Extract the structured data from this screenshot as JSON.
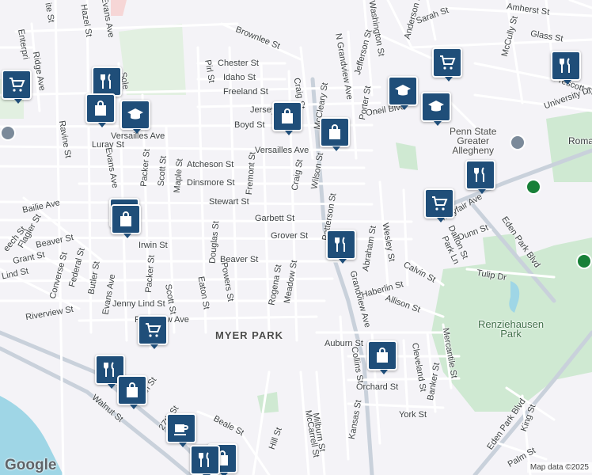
{
  "streets": [
    "Amherst St",
    "Sarah St",
    "Glass St",
    "McCully St",
    "Anderson St",
    "Washington St",
    "Jefferson St",
    "Brownlee St",
    "Chester St",
    "Idaho St",
    "Freeland St",
    "Jersey St",
    "Boyd St",
    "Oneil Blvd",
    "Prescott St",
    "University Dr",
    "Versailles Ave",
    "Atcheson St",
    "Dinsmore St",
    "Stewart St",
    "Garbett St",
    "Grover St",
    "Irwin St",
    "Beaver St",
    "Bailie Ave",
    "Jenny Lind St",
    "Riverview St",
    "Riverview Ave",
    "Luray St",
    "Ravine St",
    "Hazel St",
    "Evans Ave",
    "Packer St",
    "Scott St",
    "Maple St",
    "Fremont St",
    "Craig St",
    "Wilson St",
    "McCleary St",
    "N Grandview Ave",
    "Porter St",
    "Patterson St",
    "Abraham St",
    "Wesley St",
    "Calvin St",
    "Haberlin St",
    "Allison St",
    "Mayfair Ave",
    "Dunn St",
    "Dalton St",
    "Park Ln",
    "Eden Park Blvd",
    "Tulip Dr",
    "Grandview Ave",
    "Auburn St",
    "Collins St",
    "Cleveland St",
    "Mercantile St",
    "Banker St",
    "Orchard St",
    "York St",
    "Kansas St",
    "Milburn St",
    "McCarrell St",
    "Hill St",
    "Beale St",
    "27th St",
    "26th St",
    "Walnut St",
    "Palm St",
    "King St",
    "Douglas St",
    "Powers St",
    "Eaton St",
    "Rogena St",
    "Meadow St",
    "Butler St",
    "Converse St",
    "Federal St",
    "Grant St",
    "Flagler St",
    "Lind St",
    "Pirl St",
    "Federal St",
    "Enterprise St",
    "Ridge Ave",
    "Soles St",
    "Ite St"
  ],
  "labels": {
    "amherst": "Amherst St",
    "sarah": "Sarah St",
    "glass": "Glass St",
    "mccully": "McCully St",
    "anderson": "Anderson St",
    "washington": "Washington St",
    "jefferson": "Jefferson St",
    "brownlee": "Brownlee St",
    "chester": "Chester St",
    "idaho": "Idaho St",
    "freeland": "Freeland St",
    "jersey": "Jersey St",
    "boyd": "Boyd St",
    "oneil": "Oneil Blvd",
    "prescott": "Prescott St",
    "university": "University Dr",
    "versailles1": "Versailles Ave",
    "versailles2": "Versailles Ave",
    "atcheson": "Atcheson St",
    "dinsmore": "Dinsmore St",
    "stewart": "Stewart St",
    "garbett": "Garbett St",
    "grover": "Grover St",
    "irwin": "Irwin St",
    "beaver1": "Beaver St",
    "beaver2": "Beaver St",
    "bailie": "Bailie Ave",
    "jenny": "Jenny Lind St",
    "riverview_st": "Riverview St",
    "riverview_ave": "Riverview Ave",
    "luray": "Luray St",
    "ravine": "Ravine St",
    "hazel": "Hazel St",
    "evans1": "Evans Ave",
    "evans2": "Evans Ave",
    "evans3": "Evans Ave",
    "packer1": "Packer St",
    "packer2": "Packer St",
    "scott1": "Scott St",
    "scott2": "Scott St",
    "maple": "Maple St",
    "fremont": "Fremont St",
    "craig1": "Craig St",
    "craig2": "Craig St",
    "wilson": "Wilson St",
    "mccleary": "McCleary St",
    "ngrandview": "N Grandview Ave",
    "porter": "Porter St",
    "patterson": "Patterson St",
    "abraham": "Abraham St",
    "wesley": "Wesley St",
    "calvin": "Calvin St",
    "haberlin": "Haberlin St",
    "allison": "Allison St",
    "mayfair": "Mayfair Ave",
    "dunn": "Dunn St",
    "dalton": "Dalton St",
    "parkln": "Park Ln",
    "eden1": "Eden Park Blvd",
    "eden2": "Eden Park Blvd",
    "tulip": "Tulip Dr",
    "grandview": "Grandview Ave",
    "auburn": "Auburn St",
    "collins": "Collins St",
    "cleveland": "Cleveland St",
    "mercantile": "Mercantile St",
    "banker": "Banker St",
    "orchard": "Orchard St",
    "york": "York St",
    "kansas": "Kansas St",
    "milburn": "Milburn St",
    "mccarrell": "McCarrell St",
    "hill": "Hill St",
    "beale": "Beale St",
    "st27": "27th St",
    "st26": "26th St",
    "walnut": "Walnut St",
    "palm": "Palm St",
    "king": "King St",
    "douglas": "Douglas St",
    "powers": "Powers St",
    "eaton": "Eaton St",
    "rogena": "Rogena St",
    "meadow": "Meadow St",
    "butler": "Butler St",
    "converse": "Converse St",
    "federal": "Federal St",
    "grant": "Grant St",
    "flagler": "Flagler St",
    "lind": "Lind St",
    "pirl": "Pirl St",
    "enterprise": "Enterpri",
    "ridge": "Ridge Ave",
    "soles": "Sole",
    "ite": "ite St",
    "beech": "eech St",
    "h_frag": "H",
    "monroe": "M",
    "roma": "Roma",
    "stewart_frag": "St",
    "ave_frag": "e Ave",
    "m_frag": "M",
    "mcfrag": "McCo",
    "ela": "ela",
    "i_st": "St"
  },
  "areas": {
    "myer_park": "MYER PARK"
  },
  "parks": {
    "renziehausen": "Renziehausen\nPark"
  },
  "poi": {
    "penn_state": "Penn State\nGreater\nAllegheny"
  },
  "pins": [
    {
      "type": "shopping-cart"
    },
    {
      "type": "restaurant"
    },
    {
      "type": "shopping-bag"
    },
    {
      "type": "school"
    },
    {
      "type": "shopping-cart"
    },
    {
      "type": "restaurant"
    },
    {
      "type": "shopping-bag"
    },
    {
      "type": "school"
    },
    {
      "type": "school"
    },
    {
      "type": "shopping-bag"
    },
    {
      "type": "shopping-bag"
    },
    {
      "type": "restaurant"
    },
    {
      "type": "shopping-cart"
    },
    {
      "type": "shopping-bag"
    },
    {
      "type": "restaurant"
    },
    {
      "type": "shopping-cart"
    },
    {
      "type": "restaurant"
    },
    {
      "type": "shopping-bag"
    },
    {
      "type": "shopping-bag"
    },
    {
      "type": "cafe"
    },
    {
      "type": "restaurant"
    },
    {
      "type": "shopping-bag"
    },
    {
      "type": "restaurant"
    }
  ],
  "brand": {
    "logo": "Google",
    "attribution": "Map data ©2025"
  },
  "colors": {
    "pin": "#1f4e79",
    "park": "#cfe9d2",
    "water": "#9fd6e6",
    "land": "#f4f3f7",
    "road": "#ffffff",
    "road_major": "#c9d1db"
  }
}
